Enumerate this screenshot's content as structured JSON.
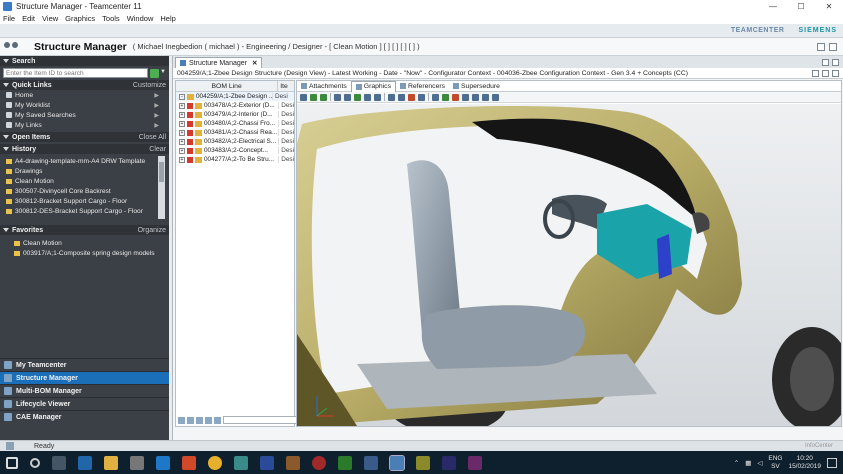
{
  "window": {
    "title": "Structure Manager - Teamcenter 11",
    "controls": [
      "—",
      "☐",
      "✕"
    ]
  },
  "menu": [
    "File",
    "Edit",
    "View",
    "Graphics",
    "Tools",
    "Window",
    "Help"
  ],
  "banner": {
    "brand1": "TEAMCENTER",
    "brand2": "SIEMENS"
  },
  "app_header": {
    "title": "Structure Manager",
    "context": "( Michael Inegbedion ( michael ) - Engineering / Designer - [ Clean Motion ] [ ] [ ] [ ] [ ] )"
  },
  "leftnav": {
    "search": {
      "title": "Search",
      "placeholder": "Enter the Item ID to search"
    },
    "quick_links": {
      "title": "Quick Links",
      "action": "Customize",
      "items": [
        "Home",
        "My Worklist",
        "My Saved Searches",
        "My Links"
      ]
    },
    "open_items": {
      "title": "Open Items",
      "action": "Close All"
    },
    "history": {
      "title": "History",
      "action": "Clear",
      "items": [
        "A4-drawing-template-mm-A4 DRW Template",
        "Drawings",
        "Clean Motion",
        "300507-Divinycell Core Backrest",
        "300812-Bracket Support Cargo - Floor",
        "300812-DES-Bracket Support Cargo - Floor"
      ]
    },
    "favorites": {
      "title": "Favorites",
      "action": "Organize",
      "items": [
        "Clean Motion",
        "003917/A;1-Composite spring design models"
      ]
    },
    "perspectives": [
      "My Teamcenter",
      "Structure Manager",
      "Multi-BOM Manager",
      "Lifecycle Viewer",
      "CAE Manager"
    ]
  },
  "status": {
    "text": "Ready",
    "right": "InfoCenter"
  },
  "center": {
    "tab": "Structure Manager",
    "context_line": "004259/A;1-Zbee Design Structure (Design View) - Latest Working - Date - \"Now\" - Configurator Context - 004036-Zbee Configuration Context - Gen 3.4 + Concepts (CC)",
    "bom": {
      "col1": "BOM Line",
      "col2": "Ite",
      "rows": [
        {
          "name": "004259/A;1-Zbee Design ...",
          "desc": "Desi"
        },
        {
          "name": "003478/A;2-Exterior (D...",
          "desc": "Desi"
        },
        {
          "name": "003479/A;2-Interior (D...",
          "desc": "Desi"
        },
        {
          "name": "003480/A;2-Chassi Fro...",
          "desc": "Desi"
        },
        {
          "name": "003481/A;2-Chassi Rea...",
          "desc": "Desi"
        },
        {
          "name": "003482/A;2-Electrical S...",
          "desc": "Desi"
        },
        {
          "name": "003483/A;2-Concept...",
          "desc": "Desi"
        },
        {
          "name": "004277/A;2-To Be Stru...",
          "desc": "Desi"
        }
      ]
    },
    "viewer_tabs": [
      "Attachments",
      "Graphics",
      "Referencers",
      "Supersedure"
    ]
  },
  "taskbar": {
    "lang1": "ENG",
    "lang2": "SV",
    "time": "10:20",
    "date": "15/02/2019"
  }
}
